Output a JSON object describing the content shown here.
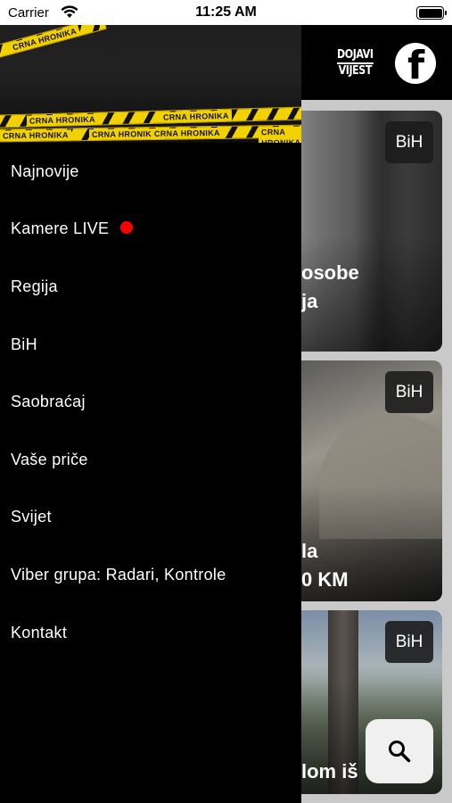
{
  "status_bar": {
    "carrier": "Carrier",
    "time": "11:25 AM"
  },
  "header": {
    "dojavi_line1": "DOJAVI",
    "dojavi_line2": "VIJEST",
    "facebook_glyph": "f"
  },
  "drawer": {
    "banner_tape_text": "CRNA HRONIKA",
    "menu_items": [
      {
        "label": "Najnovije"
      },
      {
        "label": "Kamere LIVE",
        "live_indicator_color": "#ff0000"
      },
      {
        "label": "Regija"
      },
      {
        "label": "BiH"
      },
      {
        "label": "Saobraćaj"
      },
      {
        "label": "Vaše priče"
      },
      {
        "label": "Svijet"
      },
      {
        "label": "Viber grupa: Radari, Kontrole"
      },
      {
        "label": "Kontakt"
      }
    ]
  },
  "feed": {
    "cards": [
      {
        "badge": "BiH",
        "title_line1": "osobe",
        "title_line2": "ja"
      },
      {
        "badge": "BiH",
        "title_line1": "la",
        "title_line2": "0 KM"
      },
      {
        "badge": "BiH",
        "title_line1": "lom iš"
      }
    ]
  },
  "icons": {
    "search_fab": "search-icon",
    "facebook": "facebook-icon",
    "wifi": "wifi-icon",
    "battery": "battery-icon"
  },
  "colors": {
    "drawer_background": "#000000",
    "tape_yellow": "#f2d100",
    "live_dot": "#ff0000"
  }
}
